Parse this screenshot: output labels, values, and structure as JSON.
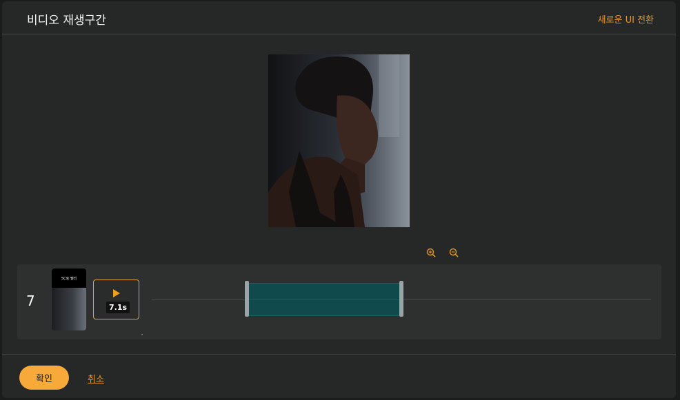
{
  "header": {
    "title": "비디오 재생구간",
    "switch_ui_label": "새로운 UI 전환"
  },
  "icons": {
    "zoom_in": "zoom-in-icon",
    "zoom_out": "zoom-out-icon",
    "play": "play-icon"
  },
  "timeline": {
    "clip_index": "7",
    "thumbnail_caption": "5C로 필터",
    "duration": "7.1s"
  },
  "footer": {
    "confirm_label": "확인",
    "cancel_label": "취소"
  },
  "colors": {
    "accent": "#f7a93a",
    "link": "#e6962e",
    "range_fill": "#114a4c",
    "background": "#262827"
  }
}
